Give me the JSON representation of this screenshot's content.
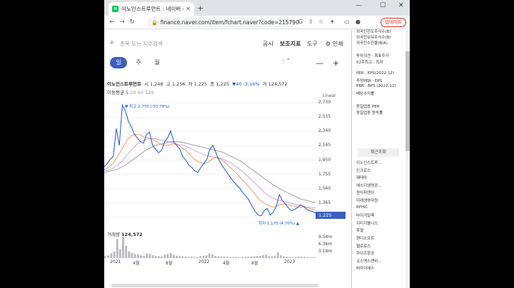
{
  "browser": {
    "tab_title": "이노인스트루먼트 : 네이버 증권",
    "tab_close": "✕",
    "new_tab": "+",
    "win_min": "—",
    "win_max": "☐",
    "win_close": "✕",
    "url": "finance.naver.com/item/fchart.naver?code=215790",
    "update_label": "업데이트"
  },
  "top": {
    "search_placeholder": "종목 또는 지수검색",
    "menu": [
      "공시",
      "보조지표",
      "도구",
      "인쇄"
    ]
  },
  "periods": [
    "일",
    "주",
    "월"
  ],
  "quote": {
    "name": "이노인스트루먼트",
    "open_label": "시",
    "open": "1,248",
    "high_label": "고",
    "high": "1,256",
    "low_label": "저",
    "low": "1,225",
    "close_label": "종",
    "close": "1,225",
    "change": "▼40 -3.16%",
    "volume_label": "거",
    "volume": "124,572"
  },
  "ma": {
    "label": "이동평균",
    "values": [
      "5",
      "20",
      "60",
      "120"
    ]
  },
  "scale_mode": "Linear",
  "current_price_tag": "1,225",
  "high_annotation": "▼ 최고 2,770 (-55.78%)",
  "low_annotation": "최저 1,170 (4.70%) ▲",
  "volume_caption": {
    "label": "거래량",
    "value": "124,572"
  },
  "volume_axis": [
    "9.54m",
    "6.36m",
    "3.18m"
  ],
  "chart_data": {
    "type": "line",
    "title": "이노인스트루먼트",
    "x_labels": [
      "2021",
      "4월",
      "8월",
      "2022",
      "4월",
      "8월",
      "2023"
    ],
    "y_ticks": [
      2730,
      2535,
      2340,
      2145,
      1950,
      1755,
      1560,
      1365,
      1170
    ],
    "y_tick_labels": [
      "2,730",
      "2,535",
      "2,340",
      "2,145",
      "1,950",
      "1,755",
      "1,560",
      "1,365",
      "1,170"
    ],
    "ylim": [
      1100,
      2800
    ],
    "series": [
      {
        "values": [
          1860,
          1900,
          1960,
          2000,
          2380,
          2150,
          2700,
          2620,
          2480,
          2400,
          2300,
          2250,
          2200,
          2180,
          2300,
          2330,
          2150,
          2100,
          2050,
          2080,
          2200,
          2250,
          2350,
          2200,
          2150,
          2100,
          2000,
          1950,
          1880,
          1850,
          1800,
          1780,
          1850,
          1900,
          1960,
          2100,
          2150,
          2050,
          1950,
          1880,
          1820,
          1760,
          1700,
          1650,
          1600,
          1560,
          1500,
          1460,
          1400,
          1320,
          1250,
          1200,
          1190,
          1260,
          1290,
          1200,
          1240,
          1320,
          1480,
          1400,
          1350,
          1300,
          1260,
          1280,
          1300,
          1340,
          1320,
          1280,
          1260,
          1250,
          1225
        ],
        "color": "#1a56db"
      },
      {
        "values": [
          1820,
          1840,
          1870,
          1910,
          1980,
          2030,
          2110,
          2180,
          2240,
          2280,
          2300,
          2300,
          2290,
          2270,
          2260,
          2250,
          2230,
          2210,
          2180,
          2160,
          2150,
          2150,
          2160,
          2170,
          2160,
          2140,
          2110,
          2080,
          2040,
          2000,
          1960,
          1930,
          1910,
          1900,
          1910,
          1940,
          1970,
          1980,
          1970,
          1950,
          1920,
          1880,
          1840,
          1800,
          1760,
          1720,
          1670,
          1630,
          1580,
          1530,
          1480,
          1430,
          1390,
          1360,
          1340,
          1320,
          1310,
          1320,
          1340,
          1350,
          1350,
          1340,
          1330,
          1320,
          1310,
          1310,
          1310,
          1300,
          1290,
          1280,
          1270
        ],
        "color": "#e8873a"
      },
      {
        "values": [
          1800,
          1810,
          1820,
          1840,
          1870,
          1900,
          1940,
          1990,
          2040,
          2090,
          2130,
          2170,
          2200,
          2220,
          2230,
          2240,
          2240,
          2240,
          2230,
          2220,
          2210,
          2200,
          2190,
          2180,
          2170,
          2160,
          2150,
          2140,
          2120,
          2100,
          2080,
          2060,
          2040,
          2020,
          2010,
          2000,
          1990,
          1990,
          1980,
          1970,
          1950,
          1930,
          1910,
          1880,
          1850,
          1820,
          1790,
          1750,
          1710,
          1670,
          1630,
          1590,
          1550,
          1510,
          1480,
          1450,
          1430,
          1410,
          1400,
          1390,
          1380,
          1370,
          1360,
          1350,
          1340,
          1330,
          1320,
          1310,
          1310,
          1300,
          1300
        ],
        "color": "#c98bd6"
      },
      {
        "values": [
          1780,
          1790,
          1800,
          1810,
          1820,
          1840,
          1860,
          1880,
          1910,
          1940,
          1970,
          2000,
          2030,
          2060,
          2090,
          2110,
          2130,
          2150,
          2160,
          2170,
          2180,
          2190,
          2200,
          2200,
          2200,
          2200,
          2190,
          2180,
          2170,
          2160,
          2150,
          2140,
          2130,
          2120,
          2110,
          2100,
          2090,
          2080,
          2070,
          2060,
          2040,
          2020,
          2000,
          1980,
          1960,
          1940,
          1910,
          1880,
          1850,
          1820,
          1790,
          1760,
          1730,
          1700,
          1670,
          1640,
          1610,
          1590,
          1560,
          1540,
          1520,
          1500,
          1480,
          1460,
          1440,
          1420,
          1410,
          1400,
          1390,
          1380,
          1370
        ],
        "color": "#8a8a8a"
      }
    ],
    "volume": [
      0.9,
      1.2,
      2.1,
      3.0,
      8.5,
      4.0,
      9.2,
      5.5,
      3.0,
      2.2,
      1.8,
      1.5,
      1.2,
      1.0,
      2.0,
      1.8,
      1.2,
      1.0,
      0.9,
      0.8,
      1.5,
      1.8,
      2.2,
      1.4,
      1.0,
      0.9,
      0.8,
      0.7,
      0.6,
      0.6,
      0.5,
      0.5,
      0.8,
      1.0,
      1.2,
      2.0,
      1.6,
      1.0,
      0.8,
      0.7,
      0.6,
      0.6,
      0.5,
      0.5,
      0.5,
      0.4,
      0.5,
      0.5,
      0.6,
      0.7,
      0.8,
      0.9,
      1.0,
      1.3,
      1.5,
      0.9,
      0.8,
      1.0,
      2.5,
      1.2,
      0.8,
      0.6,
      0.5,
      0.5,
      0.6,
      0.7,
      0.6,
      0.5,
      0.5,
      0.4,
      0.4
    ],
    "volume_max": 9.54
  },
  "right_panel": {
    "items_top": [
      "외국인한도주식수(B)",
      "외국인보유주식수(B)",
      "외국인소진율(B/A)"
    ],
    "items_mid": [
      "투자의견 · 목표주가",
      "52주최고 · 최저"
    ],
    "items_per": [
      "PER · EPS(2022.12)",
      "추정PER · EPS",
      "PBR · BPS (2022.12)",
      "배당수익률"
    ],
    "items_sector": [
      "동일업종 PER",
      "동일업종 등락률"
    ],
    "recent_tab": "최근조회",
    "recent_list": [
      "이노인스트루...",
      "인크로스",
      "제테마",
      "에스디생명공...",
      "원익피앤이",
      "미래생명자원",
      "RFHIC",
      "타이거일렉",
      "지티지웰니스",
      "휴젤",
      "핸디소프트",
      "웹로로스",
      "하이즈항공",
      "코스맥스엔비...",
      "비아이에스"
    ]
  }
}
